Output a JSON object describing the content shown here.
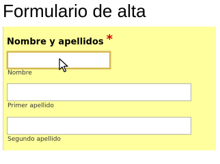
{
  "page": {
    "title": "Formulario de alta"
  },
  "form": {
    "legend": "Nombre y apellidos",
    "required_mark": "*",
    "fields": [
      {
        "caption": "Nombre",
        "value": "",
        "placeholder": ""
      },
      {
        "caption": "Primer apellido",
        "value": "",
        "placeholder": ""
      },
      {
        "caption": "Segundo apellido",
        "value": "",
        "placeholder": ""
      }
    ]
  },
  "colors": {
    "panel_background": "#ffff9e",
    "required_mark": "#cc0000",
    "focus_border": "#d4b84a"
  },
  "icons": {
    "cursor": "mouse-pointer-icon"
  }
}
